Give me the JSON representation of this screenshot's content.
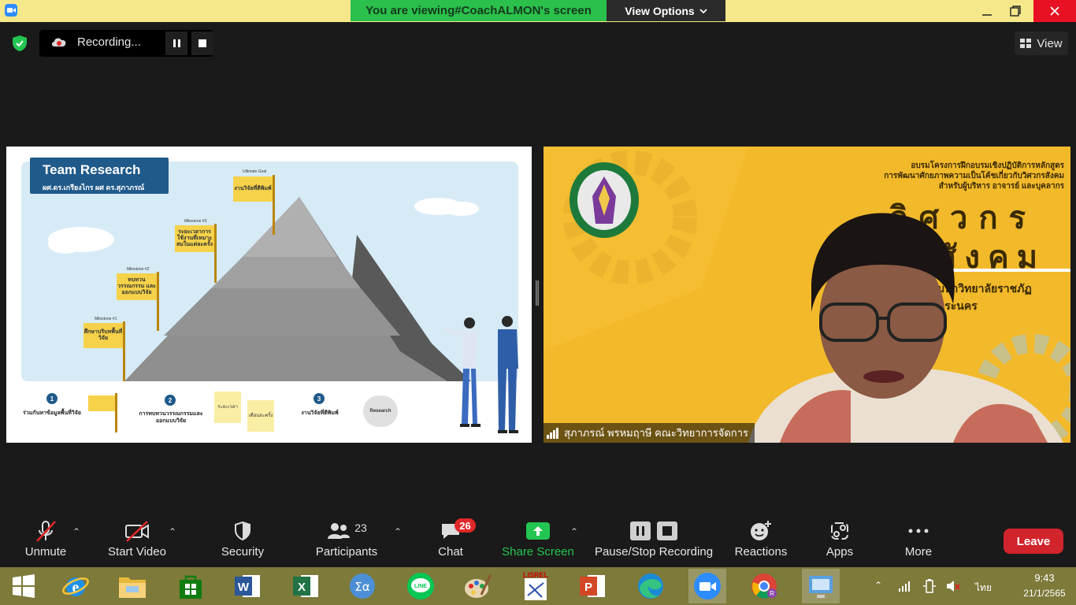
{
  "titlebar": {
    "banner_prefix": "You are viewing ",
    "banner_name": "#CoachALMON's screen",
    "view_options": "View Options"
  },
  "recording": {
    "label": "Recording..."
  },
  "view": {
    "label": "View"
  },
  "slide": {
    "title": "Team Research",
    "subtitle": "ผศ.ดร.เกรียงไกร ผศ ดร.สุภาภรณ์",
    "ultimate_goal_label": "Ultimate Goal",
    "ultimate_goal_flag": "งานวิจัยที่ตีพิมพ์",
    "milestone3_label": "Milestone #3",
    "milestone3_flag": "ระยะเวลาการใช้งานที่เหมาะสมในแต่ละครั้ง",
    "milestone2_label": "Milestone #2",
    "milestone2_flag": "ทบทวนวรรณกรรม และออกแบบวิจัย",
    "milestone1_label": "Milestone #1",
    "milestone1_flag": "ศึกษาบริบทพื้นที่วิจัย",
    "step1_num": "1",
    "step1_text": "ร่วมกันหาข้อมูลพื้นที่วิจัย",
    "step2_num": "2",
    "step2_text": "การทบทวนวรรณกรรมและออกแบบวิจัย",
    "note1": "ระยะเวลา",
    "note2": "เดือนละครั้ง",
    "step3_num": "3",
    "step3_text": "งานวิจัยที่ตีพิมพ์",
    "research_circle": "Research"
  },
  "video": {
    "header_line1": "อบรมโครงการฝึกอบรมเชิงปฏิบัติการหลักสูตร",
    "header_line2": "การพัฒนาศักยภาพความเป็นโค้ชเกี่ยวกับวิศวกรสังคม",
    "header_line3": "สำหรับผู้บริหาร อาจารย์ และบุคลากร",
    "big1": "วิศวกร",
    "big2": "สังคม",
    "university": "มหาวิทยาลัยราชภัฏพระนคร",
    "participant_name": "สุภาภรณ์ พรหมฤาษี คณะวิทยาการจัดการ"
  },
  "toolbar": {
    "unmute": "Unmute",
    "start_video": "Start Video",
    "security": "Security",
    "participants": "Participants",
    "participants_count": "23",
    "chat": "Chat",
    "chat_badge": "26",
    "share_screen": "Share Screen",
    "pause_stop": "Pause/Stop Recording",
    "reactions": "Reactions",
    "apps": "Apps",
    "more": "More",
    "leave": "Leave"
  },
  "taskbar": {
    "lang": "ไทย",
    "time": "9:43",
    "date": "21/1/2565"
  },
  "colors": {
    "banner_green": "#2bc04c",
    "share_green": "#23c552",
    "leave_red": "#d1242c",
    "chat_badge_red": "#e02828",
    "slide_blue": "#1f5a8a",
    "video_yellow": "#f2b92a"
  }
}
